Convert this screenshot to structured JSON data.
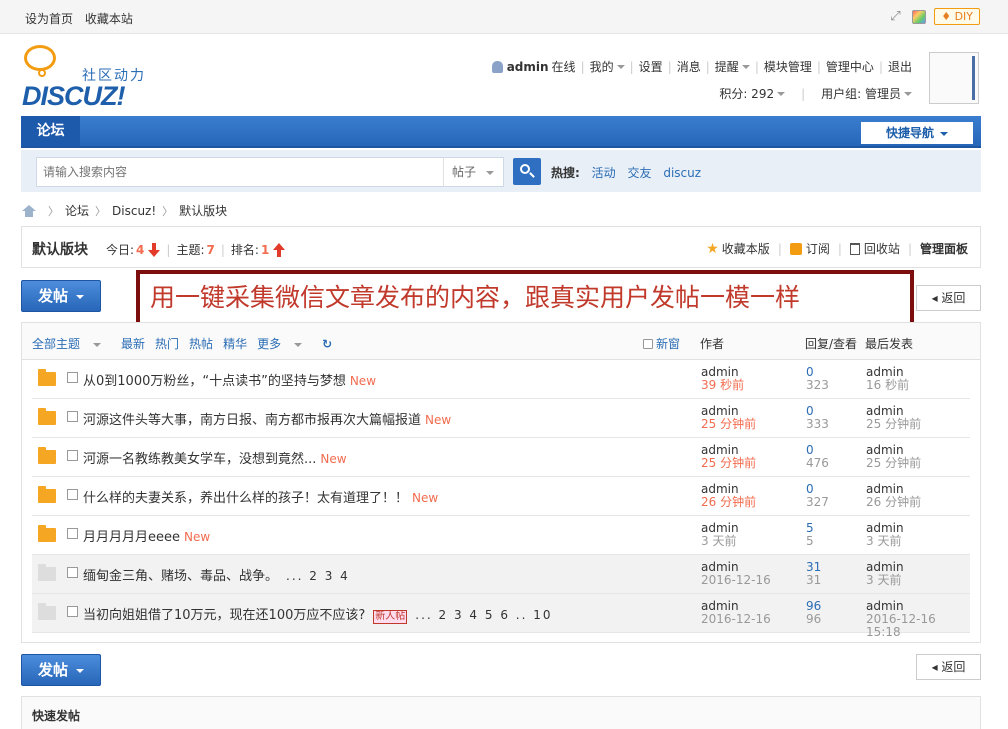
{
  "topbar": {
    "set_home": "设为首页",
    "bookmark": "收藏本站",
    "diy_label": "DIY"
  },
  "logo": {
    "cn": "社区动力",
    "en": "DISCUZ!"
  },
  "user": {
    "name": "admin",
    "status": "在线",
    "menu": [
      "我的",
      "设置",
      "消息",
      "提醒",
      "模块管理",
      "管理中心",
      "退出"
    ],
    "points": "积分: 292",
    "group": "用户组: 管理员"
  },
  "nav": {
    "tab": "论坛",
    "quick": "快捷导航"
  },
  "search": {
    "placeholder": "请输入搜索内容",
    "scope": "帖子",
    "hot_label": "热搜:",
    "hot_terms": [
      "活动",
      "交友",
      "discuz"
    ]
  },
  "breadcrumb": [
    "论坛",
    "Discuz!",
    "默认版块"
  ],
  "forum": {
    "name": "默认版块",
    "today_label": "今日:",
    "today": "4",
    "topics_label": "主题:",
    "topics": "7",
    "rank_label": "排名:",
    "rank": "1",
    "favorite": "收藏本版",
    "subscribe": "订阅",
    "recycle": "回收站",
    "manage": "管理面板"
  },
  "buttons": {
    "post": "发帖",
    "back": "返回"
  },
  "banner": "用一键采集微信文章发布的内容，跟真实用户发帖一模一样",
  "thread_head": {
    "filters": [
      "全部主题",
      "最新",
      "热门",
      "热帖",
      "精华",
      "更多"
    ],
    "new_window": "新窗",
    "author": "作者",
    "replies": "回复/查看",
    "last": "最后发表"
  },
  "threads": [
    {
      "title": "从0到1000万粉丝，“十点读书”的坚持与梦想",
      "new": "New",
      "author": "admin",
      "time": "39 秒前",
      "replies": "0",
      "views": "323",
      "last_user": "admin",
      "last_time": "16 秒前",
      "hot": true
    },
    {
      "title": "河源这件头等大事，南方日报、南方都市报再次大篇幅报道",
      "new": "New",
      "author": "admin",
      "time": "25 分钟前",
      "replies": "0",
      "views": "333",
      "last_user": "admin",
      "last_time": "25 分钟前",
      "hot": true
    },
    {
      "title": "河源一名教练教美女学车，没想到竟然...",
      "new": "New",
      "author": "admin",
      "time": "25 分钟前",
      "replies": "0",
      "views": "476",
      "last_user": "admin",
      "last_time": "25 分钟前",
      "hot": true
    },
    {
      "title": "什么样的夫妻关系，养出什么样的孩子！太有道理了！！",
      "new": "New",
      "author": "admin",
      "time": "26 分钟前",
      "replies": "0",
      "views": "327",
      "last_user": "admin",
      "last_time": "26 分钟前",
      "hot": true
    },
    {
      "title": "月月月月月eeee",
      "new": "New",
      "author": "admin",
      "time": "3 天前",
      "replies": "5",
      "views": "5",
      "last_user": "admin",
      "last_time": "3 天前",
      "hot": false
    },
    {
      "title": "缅甸金三角、赌场、毒品、战争。",
      "pages": "... 2 3 4",
      "author": "admin",
      "time": "2016-12-16",
      "replies": "31",
      "views": "31",
      "last_user": "admin",
      "last_time": "3 天前",
      "hot": false
    },
    {
      "title": "当初向姐姐借了10万元，现在还100万应不应该?",
      "newpost": "新人帖",
      "pages": "... 2 3 4 5 6 .. 10",
      "author": "admin",
      "time": "2016-12-16",
      "replies": "96",
      "views": "96",
      "last_user": "admin",
      "last_time": "2016-12-16 15:18",
      "hot": false
    }
  ],
  "quick_post": "快速发帖"
}
